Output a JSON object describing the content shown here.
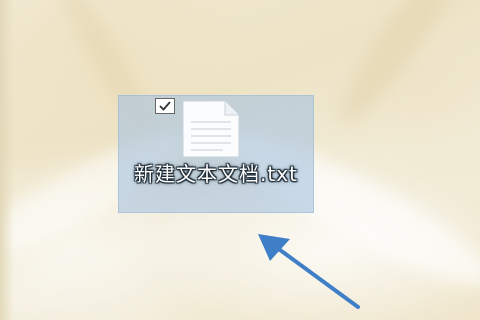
{
  "desktop": {
    "file": {
      "name": "新建文本文档.txt",
      "icon": "text-document-icon",
      "selected": true,
      "checkbox_checked": true
    },
    "annotation": {
      "icon": "pointer-arrow-icon",
      "color": "#3f7fc7"
    },
    "colors": {
      "selection_fill": "#a8c4de",
      "wallpaper": "#efe6cc"
    }
  }
}
